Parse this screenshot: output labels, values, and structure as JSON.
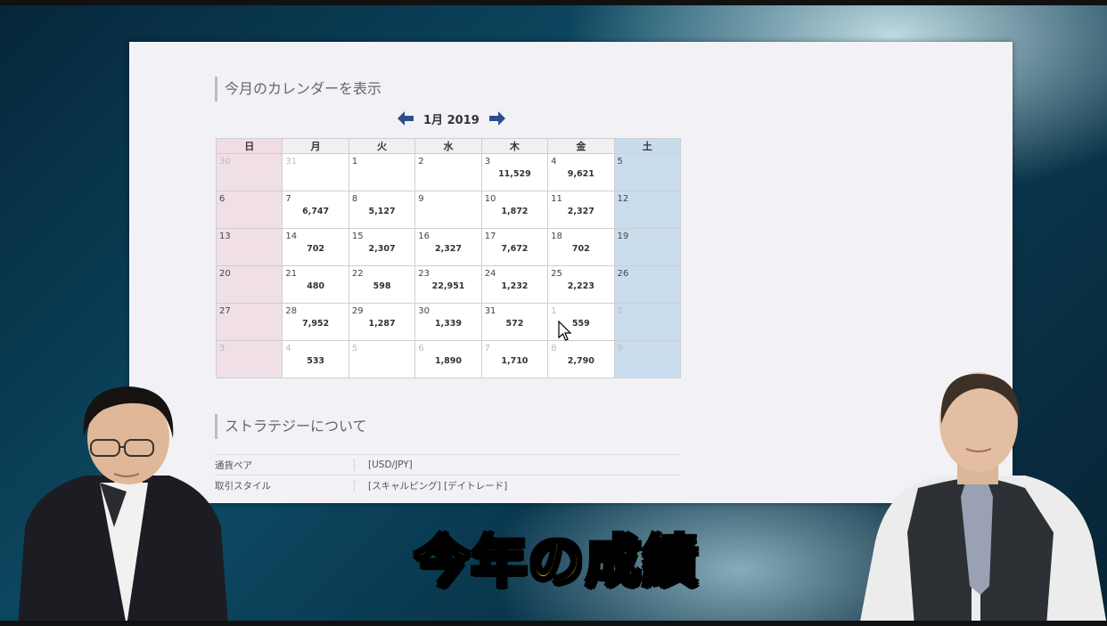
{
  "calendar": {
    "section_title": "今月のカレンダーを表示",
    "month_label": "1月 2019",
    "weekdays": [
      "日",
      "月",
      "火",
      "水",
      "木",
      "金",
      "土"
    ],
    "weeks": [
      [
        {
          "d": "30",
          "v": "",
          "other": true
        },
        {
          "d": "31",
          "v": "",
          "other": true
        },
        {
          "d": "1",
          "v": ""
        },
        {
          "d": "2",
          "v": ""
        },
        {
          "d": "3",
          "v": "11,529"
        },
        {
          "d": "4",
          "v": "9,621"
        },
        {
          "d": "5",
          "v": ""
        }
      ],
      [
        {
          "d": "6",
          "v": ""
        },
        {
          "d": "7",
          "v": "6,747"
        },
        {
          "d": "8",
          "v": "5,127"
        },
        {
          "d": "9",
          "v": ""
        },
        {
          "d": "10",
          "v": "1,872"
        },
        {
          "d": "11",
          "v": "2,327"
        },
        {
          "d": "12",
          "v": ""
        }
      ],
      [
        {
          "d": "13",
          "v": ""
        },
        {
          "d": "14",
          "v": "702"
        },
        {
          "d": "15",
          "v": "2,307"
        },
        {
          "d": "16",
          "v": "2,327"
        },
        {
          "d": "17",
          "v": "7,672"
        },
        {
          "d": "18",
          "v": "702"
        },
        {
          "d": "19",
          "v": ""
        }
      ],
      [
        {
          "d": "20",
          "v": ""
        },
        {
          "d": "21",
          "v": "480"
        },
        {
          "d": "22",
          "v": "598"
        },
        {
          "d": "23",
          "v": "22,951"
        },
        {
          "d": "24",
          "v": "1,232"
        },
        {
          "d": "25",
          "v": "2,223"
        },
        {
          "d": "26",
          "v": ""
        }
      ],
      [
        {
          "d": "27",
          "v": ""
        },
        {
          "d": "28",
          "v": "7,952"
        },
        {
          "d": "29",
          "v": "1,287"
        },
        {
          "d": "30",
          "v": "1,339"
        },
        {
          "d": "31",
          "v": "572"
        },
        {
          "d": "1",
          "v": "559",
          "other": true
        },
        {
          "d": "2",
          "v": "",
          "other": true
        }
      ],
      [
        {
          "d": "3",
          "v": "",
          "other": true
        },
        {
          "d": "4",
          "v": "533",
          "other": true
        },
        {
          "d": "5",
          "v": "",
          "other": true
        },
        {
          "d": "6",
          "v": "1,890",
          "other": true
        },
        {
          "d": "7",
          "v": "1,710",
          "other": true
        },
        {
          "d": "8",
          "v": "2,790",
          "other": true
        },
        {
          "d": "9",
          "v": "",
          "other": true
        }
      ]
    ]
  },
  "strategy": {
    "section_title": "ストラテジーについて",
    "rows": [
      {
        "key": "通貨ペア",
        "value": "[USD/JPY]"
      },
      {
        "key": "取引スタイル",
        "value": "[スキャルピング] [デイトレード]"
      }
    ]
  },
  "caption": "今年の成績",
  "colors": {
    "arrow": "#2a4e8a",
    "caption": "#fff200",
    "sunday": "#f0dfe7",
    "saturday": "#c9ddee"
  },
  "icons": {
    "prev": "arrow-left-icon",
    "next": "arrow-right-icon",
    "cursor": "mouse-pointer-icon"
  }
}
